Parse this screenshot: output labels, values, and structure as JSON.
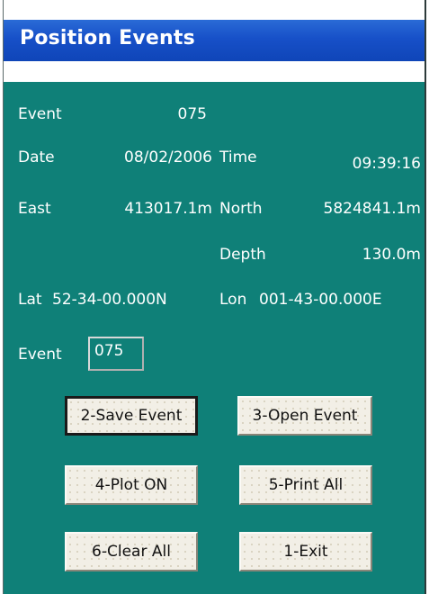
{
  "window": {
    "title": "Position Events"
  },
  "fields": {
    "event_label": "Event",
    "event_value": "075",
    "date_label": "Date",
    "date_value": "08/02/2006",
    "time_label": "Time",
    "time_value": "09:39:16",
    "east_label": "East",
    "east_value": "413017.1m",
    "north_label": "North",
    "north_value": "5824841.1m",
    "depth_label": "Depth",
    "depth_value": "130.0m",
    "lat_label": "Lat",
    "lat_value": "52-34-00.000N",
    "lon_label": "Lon",
    "lon_value": "001-43-00.000E"
  },
  "event_input": {
    "label": "Event",
    "value": "075"
  },
  "buttons": {
    "save_event": "2-Save Event",
    "open_event": "3-Open Event",
    "plot_on": "4-Plot ON",
    "print_all": "5-Print All",
    "clear_all": "6-Clear All",
    "exit": "1-Exit"
  },
  "colors": {
    "panel": "#0f8078",
    "title_bar": "#1750c8",
    "text": "#ffffff",
    "button_face": "#f2efe6"
  }
}
